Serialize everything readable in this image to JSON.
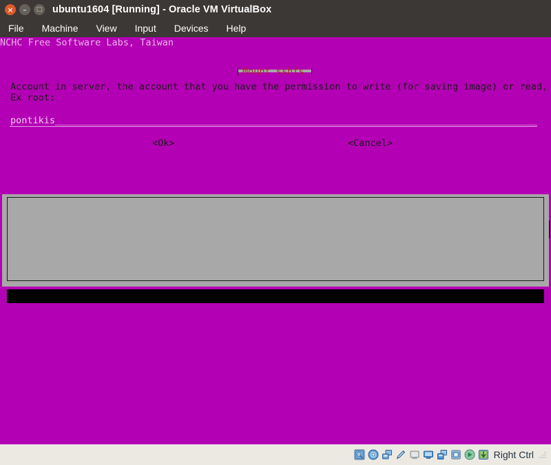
{
  "window": {
    "title": "ubuntu1604 [Running] - Oracle VM VirtualBox",
    "buttons": {
      "close": "×",
      "minimize": "–",
      "maximize": "□"
    }
  },
  "menubar": {
    "items": [
      {
        "label": "File"
      },
      {
        "label": "Machine"
      },
      {
        "label": "View"
      },
      {
        "label": "Input"
      },
      {
        "label": "Devices"
      },
      {
        "label": "Help"
      }
    ]
  },
  "guest": {
    "banner": "NCHC Free Software Labs, Taiwan",
    "background_color": "#b400b4"
  },
  "dialog": {
    "title": "Mount sshfs",
    "title_color": "#b02424",
    "background_color": "#a8a8a8",
    "prompt_line_1": "Account in server, the account that you have the permission to write (for saving image) or read,",
    "prompt_line_2": "Ex root:",
    "input": {
      "value": "pontikis",
      "filler": "________________________________________________________________________________________",
      "field_color": "#b400b4",
      "text_color": "#efcfef"
    },
    "buttons": {
      "ok": "<Ok>",
      "cancel": "<Cancel>"
    }
  },
  "statusbar": {
    "icons": [
      {
        "name": "hard-disk-icon"
      },
      {
        "name": "optical-disk-icon"
      },
      {
        "name": "floppy-disk-icon"
      },
      {
        "name": "audio-icon"
      },
      {
        "name": "network-icon"
      },
      {
        "name": "display-icon"
      },
      {
        "name": "shared-folders-icon"
      },
      {
        "name": "usb-icon"
      },
      {
        "name": "mouse-integration-icon"
      },
      {
        "name": "host-key-icon"
      }
    ],
    "host_key_label": "Right Ctrl"
  }
}
